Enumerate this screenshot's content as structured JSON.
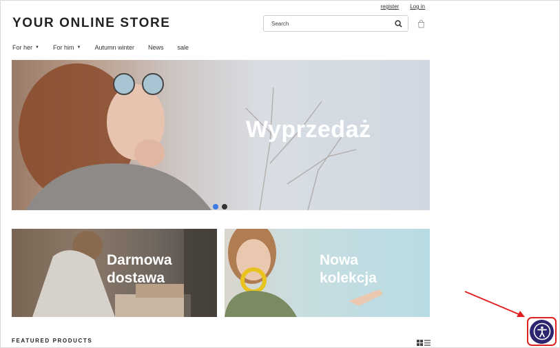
{
  "header": {
    "logo": "YOUR ONLINE STORE",
    "register": "register",
    "login": "Log in",
    "search_placeholder": "Search"
  },
  "nav": {
    "items": [
      {
        "label": "For her",
        "has_dropdown": true
      },
      {
        "label": "For him",
        "has_dropdown": true
      },
      {
        "label": "Autumn winter",
        "has_dropdown": false
      },
      {
        "label": "News",
        "has_dropdown": false
      },
      {
        "label": "sale",
        "has_dropdown": false
      }
    ]
  },
  "hero": {
    "title": "Wyprzedaż",
    "slides_count": 2,
    "active_slide": 1
  },
  "promos": {
    "left": {
      "line1": "Darmowa",
      "line2": "dostawa"
    },
    "right": {
      "line1": "Nowa",
      "line2": "kolekcja"
    }
  },
  "featured": {
    "title": "FEATURED PRODUCTS"
  },
  "colors": {
    "accent_dot": "#3a7ae2",
    "a11y_button": "#2e2570",
    "highlight_red": "#e02020"
  },
  "icons": {
    "search": "search-icon",
    "cart": "cart-icon",
    "grid_view": "grid-view-icon",
    "list_view": "list-view-icon",
    "accessibility": "accessibility-icon"
  }
}
